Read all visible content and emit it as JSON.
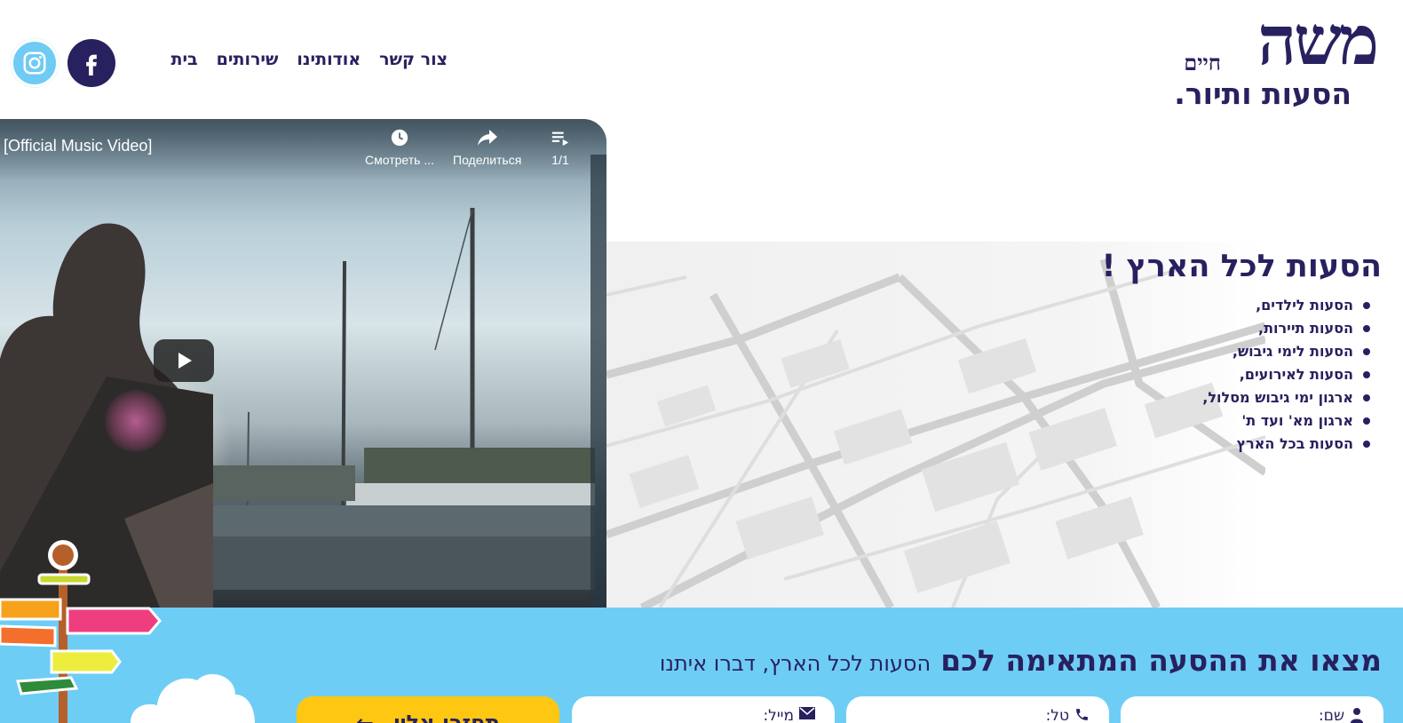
{
  "brand": {
    "logo_main": "משה",
    "logo_small": "חיים",
    "logo_sub": "הסעות ותיור."
  },
  "nav": {
    "items": [
      {
        "label": "בית"
      },
      {
        "label": "שירותים"
      },
      {
        "label": "אודותינו"
      },
      {
        "label": "צור קשר"
      }
    ]
  },
  "social": {
    "facebook_icon": "facebook-icon",
    "instagram_icon": "instagram-icon",
    "facebook_color": "#27215f",
    "instagram_color": "#6ecbf4"
  },
  "video": {
    "title": "[Official Music Video]",
    "watch_later_label": "Смотреть ...",
    "share_label": "Поделиться",
    "playlist_label": "1/1",
    "play_icon": "play-icon"
  },
  "services": {
    "title": "הסעות לכל הארץ !",
    "items": [
      {
        "label": "הסעות לילדים,"
      },
      {
        "label": "הסעות תיירות,"
      },
      {
        "label": "הסעות לימי גיבוש,"
      },
      {
        "label": "הסעות לאירועים,"
      },
      {
        "label": "ארגון ימי גיבוש מסלול,"
      },
      {
        "label": "ארגון מא' ועד ת'"
      },
      {
        "label": "הסעות בכל הארץ"
      }
    ]
  },
  "contact": {
    "heading_big": "מצאו את ההסעה המתאימה לכם",
    "heading_small": "הסעות לכל הארץ, דברו איתנו",
    "name_label": "שם:",
    "phone_label": "טל:",
    "email_label": "מייל:",
    "submit_label": "תחזרו אליי",
    "band_color": "#6ecdf5",
    "button_color": "#fdc712"
  }
}
